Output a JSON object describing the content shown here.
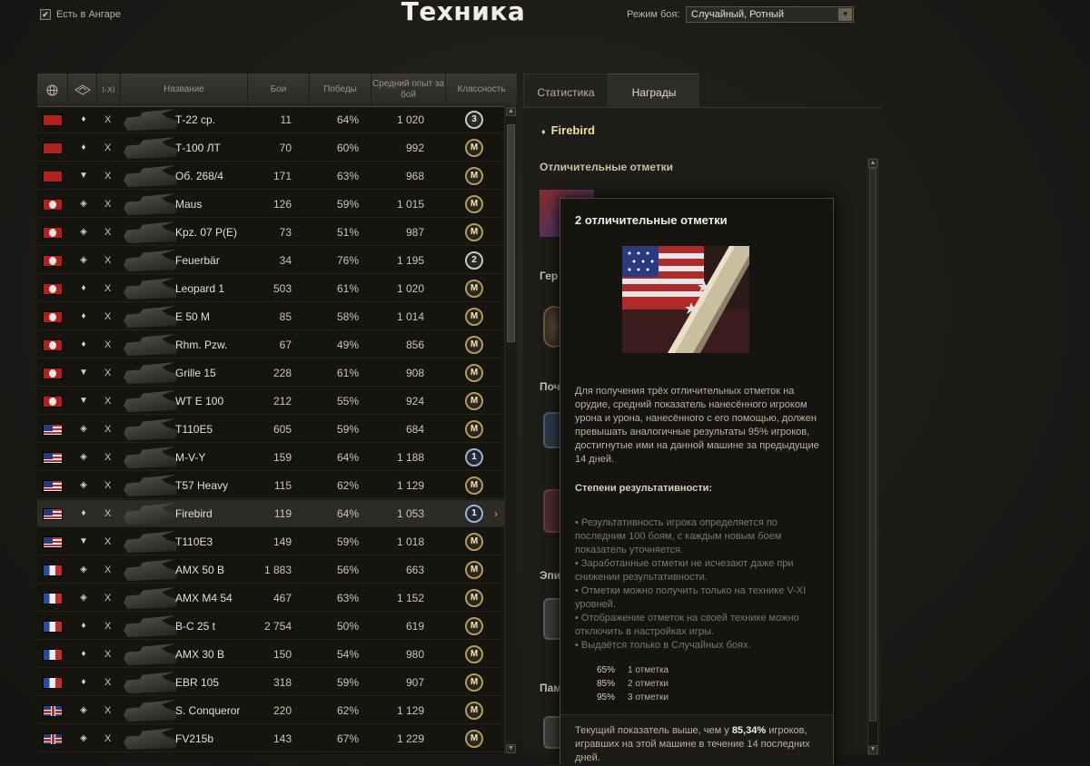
{
  "header": {
    "hangar_check": "Есть в Ангаре",
    "title": "Техника",
    "mode_label": "Режим боя:",
    "mode_value": "Случайный, Ротный"
  },
  "table": {
    "columns": {
      "level": "I-XI",
      "name": "Название",
      "battles": "Бои",
      "wins": "Победы",
      "xp": "Средний опыт за бой",
      "mastery": "Классность"
    },
    "rows": [
      {
        "nation": "su",
        "cls": "♦",
        "lvl": "X",
        "name": "Т-22 ср.",
        "battles": "11",
        "wins": "64%",
        "xp": "1 020",
        "mastery": "3",
        "mtype": "silver"
      },
      {
        "nation": "su",
        "cls": "♦",
        "lvl": "X",
        "name": "Т-100 ЛТ",
        "battles": "70",
        "wins": "60%",
        "xp": "992",
        "mastery": "M",
        "mtype": "gold"
      },
      {
        "nation": "su",
        "cls": "▼",
        "lvl": "X",
        "name": "Об. 268/4",
        "battles": "171",
        "wins": "63%",
        "xp": "968",
        "mastery": "M",
        "mtype": "gold"
      },
      {
        "nation": "de",
        "cls": "◈",
        "lvl": "X",
        "name": "Maus",
        "battles": "126",
        "wins": "59%",
        "xp": "1 015",
        "mastery": "M",
        "mtype": "gold"
      },
      {
        "nation": "de",
        "cls": "◈",
        "lvl": "X",
        "name": "Kpz. 07 P(E)",
        "battles": "73",
        "wins": "51%",
        "xp": "987",
        "mastery": "M",
        "mtype": "gold"
      },
      {
        "nation": "de",
        "cls": "◈",
        "lvl": "X",
        "name": "Feuerbär",
        "battles": "34",
        "wins": "76%",
        "xp": "1 195",
        "mastery": "2",
        "mtype": "silver"
      },
      {
        "nation": "de",
        "cls": "♦",
        "lvl": "X",
        "name": "Leopard 1",
        "battles": "503",
        "wins": "61%",
        "xp": "1 020",
        "mastery": "M",
        "mtype": "gold"
      },
      {
        "nation": "de",
        "cls": "♦",
        "lvl": "X",
        "name": "E 50 M",
        "battles": "85",
        "wins": "58%",
        "xp": "1 014",
        "mastery": "M",
        "mtype": "gold"
      },
      {
        "nation": "de",
        "cls": "♦",
        "lvl": "X",
        "name": "Rhm. Pzw.",
        "battles": "67",
        "wins": "49%",
        "xp": "856",
        "mastery": "M",
        "mtype": "gold"
      },
      {
        "nation": "de",
        "cls": "▼",
        "lvl": "X",
        "name": "Grille 15",
        "battles": "228",
        "wins": "61%",
        "xp": "908",
        "mastery": "M",
        "mtype": "gold"
      },
      {
        "nation": "de",
        "cls": "▼",
        "lvl": "X",
        "name": "WT E 100",
        "battles": "212",
        "wins": "55%",
        "xp": "924",
        "mastery": "M",
        "mtype": "gold"
      },
      {
        "nation": "us",
        "cls": "◈",
        "lvl": "X",
        "name": "T110E5",
        "battles": "605",
        "wins": "59%",
        "xp": "684",
        "mastery": "M",
        "mtype": "gold"
      },
      {
        "nation": "us",
        "cls": "◈",
        "lvl": "X",
        "name": "M-V-Y",
        "battles": "159",
        "wins": "64%",
        "xp": "1 188",
        "mastery": "1",
        "mtype": "blue"
      },
      {
        "nation": "us",
        "cls": "◈",
        "lvl": "X",
        "name": "T57 Heavy",
        "battles": "115",
        "wins": "62%",
        "xp": "1 129",
        "mastery": "M",
        "mtype": "gold"
      },
      {
        "nation": "us",
        "cls": "♦",
        "lvl": "X",
        "name": "Firebird",
        "battles": "119",
        "wins": "64%",
        "xp": "1 053",
        "mastery": "1",
        "mtype": "blue",
        "selected": true
      },
      {
        "nation": "us",
        "cls": "▼",
        "lvl": "X",
        "name": "T110E3",
        "battles": "149",
        "wins": "59%",
        "xp": "1 018",
        "mastery": "M",
        "mtype": "gold"
      },
      {
        "nation": "fr",
        "cls": "◈",
        "lvl": "X",
        "name": "AMX 50 B",
        "battles": "1 883",
        "wins": "56%",
        "xp": "663",
        "mastery": "M",
        "mtype": "gold"
      },
      {
        "nation": "fr",
        "cls": "◈",
        "lvl": "X",
        "name": "AMX M4 54",
        "battles": "467",
        "wins": "63%",
        "xp": "1 152",
        "mastery": "M",
        "mtype": "gold"
      },
      {
        "nation": "fr",
        "cls": "♦",
        "lvl": "X",
        "name": "B-C 25 t",
        "battles": "2 754",
        "wins": "50%",
        "xp": "619",
        "mastery": "M",
        "mtype": "gold"
      },
      {
        "nation": "fr",
        "cls": "♦",
        "lvl": "X",
        "name": "AMX 30 B",
        "battles": "150",
        "wins": "54%",
        "xp": "980",
        "mastery": "M",
        "mtype": "gold"
      },
      {
        "nation": "fr",
        "cls": "♦",
        "lvl": "X",
        "name": "EBR 105",
        "battles": "318",
        "wins": "59%",
        "xp": "907",
        "mastery": "M",
        "mtype": "gold"
      },
      {
        "nation": "uk",
        "cls": "◈",
        "lvl": "X",
        "name": "S. Conqueror",
        "battles": "220",
        "wins": "62%",
        "xp": "1 129",
        "mastery": "M",
        "mtype": "gold"
      },
      {
        "nation": "uk",
        "cls": "◈",
        "lvl": "X",
        "name": "FV215b",
        "battles": "143",
        "wins": "67%",
        "xp": "1 229",
        "mastery": "M",
        "mtype": "gold"
      }
    ]
  },
  "right": {
    "tabs": [
      "Статистика",
      "Награды"
    ],
    "vehicle": "Firebird",
    "sections": [
      "Отличительные отметки",
      "Гер",
      "Поч",
      "Эпи",
      "Пам"
    ]
  },
  "tooltip": {
    "title": "2 отличительные отметки",
    "description": "Для получения трёх отличительных отметок на орудие, средний показатель нанесённого игроком урона и урона, нанесённого с его помощью, должен превышать аналогичные результаты 95% игроков, достигнутые ими на данной машине за предыдущие 14 дней.",
    "subheading": "Степени результативности:",
    "bullets": [
      "• Результативность игрока определяется по последним 100 боям, с каждым новым боем показатель уточняется.",
      "• Заработанные отметки не исчезают даже при снижении результативности.",
      "• Отметки можно получить только на технике V-XI уровней.",
      "• Отображение отметок на своей технике можно отключить в настройках игры.",
      "• Выдаётся только в Случайных боях."
    ],
    "thresholds": [
      {
        "pct": "65%",
        "text": "1 отметка"
      },
      {
        "pct": "85%",
        "text": "2 отметки"
      },
      {
        "pct": "95%",
        "text": "3 отметки"
      }
    ],
    "footer_before": "Текущий показатель выше, чем у",
    "footer_value": "85,34%",
    "footer_after": "игроков, игравших на этой машине в течение 14 последних дней."
  }
}
